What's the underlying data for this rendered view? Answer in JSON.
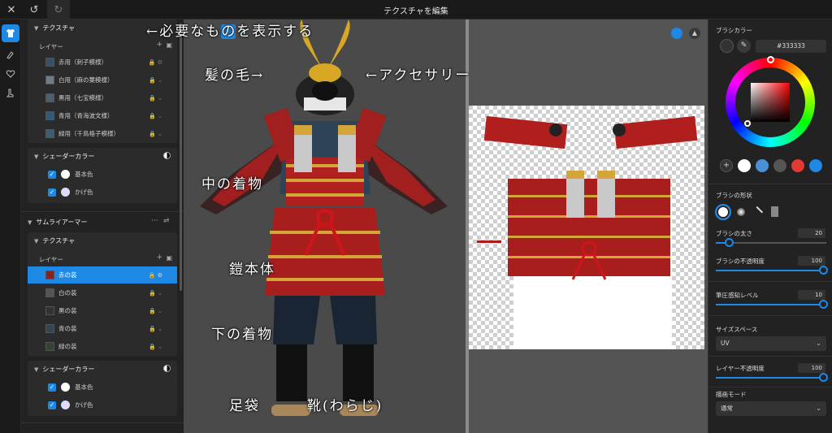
{
  "topbar": {
    "title": "テクスチャを編集"
  },
  "left_panel": {
    "outfit1": {
      "texture_header": "テクスチャ",
      "layers_label": "レイヤー",
      "layers": [
        {
          "label": "赤用（刺子模様）",
          "thumb_color": "#35506a"
        },
        {
          "label": "白用（麻の葉模様）",
          "thumb_color": "#6f7d8a"
        },
        {
          "label": "黒用（七宝模様）",
          "thumb_color": "#4b5f71"
        },
        {
          "label": "青用（青海波文様）",
          "thumb_color": "#2f5a79"
        },
        {
          "label": "緑用（千鳥格子模様）",
          "thumb_color": "#3b5e70"
        }
      ],
      "shader_header": "シェーダーカラー",
      "shader_items": [
        {
          "label": "基本色",
          "color": "#ffffff"
        },
        {
          "label": "かげ色",
          "color": "#dcdcff"
        }
      ]
    },
    "outfit2": {
      "title": "サムライアーマー",
      "texture_header": "テクスチャ",
      "layers_label": "レイヤー",
      "layers": [
        {
          "label": "赤の装",
          "thumb_color": "#8a2020",
          "selected": true
        },
        {
          "label": "白の装",
          "thumb_color": "#555555"
        },
        {
          "label": "黒の装",
          "thumb_color": "#333333"
        },
        {
          "label": "青の装",
          "thumb_color": "#334455"
        },
        {
          "label": "緑の装",
          "thumb_color": "#334433"
        }
      ],
      "shader_header": "シェーダーカラー",
      "shader_items": [
        {
          "label": "基本色",
          "color": "#ffffff"
        },
        {
          "label": "かげ色",
          "color": "#dcdcff"
        }
      ]
    }
  },
  "annotations": {
    "show_needed": "←必要なものを表示する",
    "hair": "髪の毛→",
    "accessory": "←アクセサリー",
    "inner_kimono": "中の着物",
    "armor_body": "鎧本体",
    "lower_kimono": "下の着物",
    "socks": "足袋",
    "shoes": "靴(わらじ)"
  },
  "right_panel": {
    "brush_color_label": "ブラシカラー",
    "hex_value": "#333333",
    "palette": [
      "#ffffff",
      "#4a90d9",
      "#555555",
      "#e53935",
      "#1e88e5"
    ],
    "brush_shape_label": "ブラシの形状",
    "brush_size_label": "ブラシの太さ",
    "brush_size_value": "20",
    "brush_opacity_label": "ブラシの不透明度",
    "brush_opacity_value": "100",
    "pressure_label": "筆圧感知レベル",
    "pressure_value": "10",
    "size_space_label": "サイズスペース",
    "size_space_value": "UV",
    "layer_opacity_label": "レイヤー不透明度",
    "layer_opacity_value": "100",
    "draw_mode_label": "描画モード",
    "draw_mode_value": "通常"
  }
}
